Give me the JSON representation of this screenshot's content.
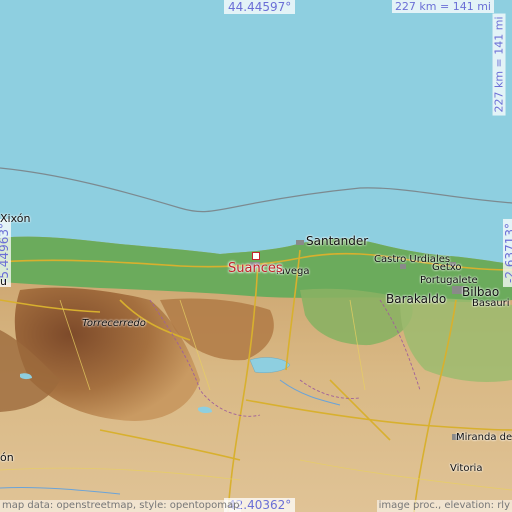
{
  "map": {
    "coordinates": {
      "north": "44.44597°",
      "south": "42.40362°",
      "west": "-5.44963°",
      "east": "-2.63713°"
    },
    "scale": {
      "top": "227 km = 141 mi",
      "right": "227 km = 141 mi"
    },
    "attribution": {
      "left": "map data: openstreetmap, style: opentopomap",
      "right": "image proc., elevation: rly"
    },
    "highlight": {
      "name": "Suances"
    },
    "places": {
      "xixon": "Xixón",
      "santander": "Santander",
      "castro_urdiales": "Castro Urdiales",
      "torrelavega": "lavega",
      "getxo": "Getxo",
      "portugalete": "Portugalete",
      "barakaldo": "Barakaldo",
      "bilbao": "Bilbao",
      "basauri": "Basauri",
      "torrecerredo": "Torrecerredo",
      "miranda": "Miranda de",
      "vitoria": "Vitoria",
      "left_edge": "u",
      "left_bottom": "ón"
    },
    "colors": {
      "sea": "#8ecfe0",
      "lowland": "#5fa65a",
      "highland": "#a0683e",
      "plateau": "#d7b580",
      "highlight": "#c4232b",
      "label_blue": "#6b6fd6"
    }
  }
}
